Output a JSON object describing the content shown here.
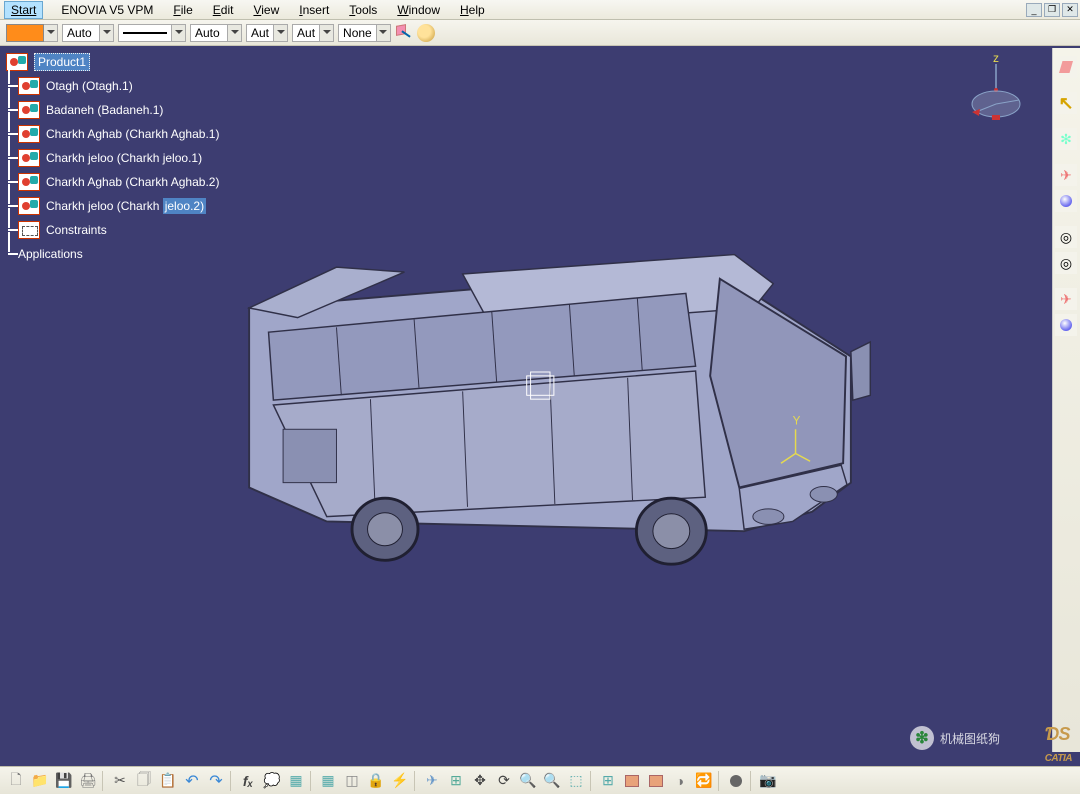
{
  "menu": {
    "start": "Start",
    "enovia": "ENOVIA V5 VPM",
    "file": "File",
    "edit": "Edit",
    "view": "View",
    "insert": "Insert",
    "tools": "Tools",
    "window": "Window",
    "help": "Help"
  },
  "window_controls": {
    "min": "_",
    "restore": "❐",
    "close": "✕"
  },
  "props": {
    "color": "#ff8c1a",
    "transparency": "Auto",
    "lineweight": "Auto",
    "linetype": "Aut",
    "pointtype": "Aut",
    "render": "None"
  },
  "tree": {
    "root": "Product1",
    "items": [
      "Otagh (Otagh.1)",
      "Badaneh (Badaneh.1)",
      "Charkh Aghab (Charkh Aghab.1)",
      "Charkh jeloo (Charkh jeloo.1)",
      "Charkh Aghab (Charkh Aghab.2)"
    ],
    "item_sel_a": "Charkh jeloo (Charkh ",
    "item_sel_b": "jeloo.2)",
    "constraints": "Constraints",
    "applications": "Applications"
  },
  "compass_axis": "z",
  "bottom": {
    "labels": [
      "new",
      "open",
      "save",
      "print",
      "cut",
      "copy",
      "paste",
      "undo",
      "redo",
      "formula",
      "comment",
      "spreadsheet",
      "hierarchy",
      "lock",
      "macro",
      "fly",
      "fit-all",
      "pan",
      "rotate",
      "zoom-in",
      "zoom-out",
      "normal-view",
      "multiview",
      "shading",
      "hide-show",
      "swap-visible",
      "storage",
      "capture"
    ]
  },
  "right_toolbar": [
    "assembly",
    "select",
    "snowflake",
    "fly-through",
    "render-ball",
    "render-ball",
    "target",
    "target",
    "fly-through",
    "render-ball"
  ],
  "watermark": {
    "text": "机械图纸狗",
    "logo": "CATIA"
  }
}
